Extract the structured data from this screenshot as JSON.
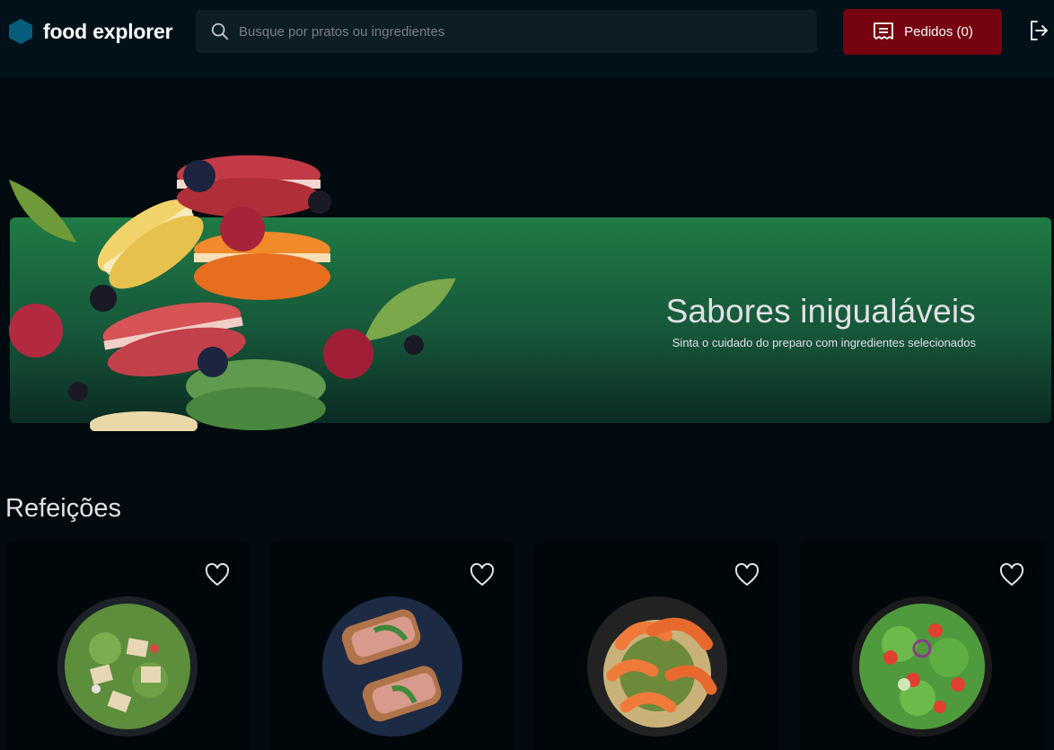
{
  "header": {
    "brand": "food explorer",
    "search_placeholder": "Busque por pratos ou ingredientes",
    "orders_label": "Pedidos (0)"
  },
  "banner": {
    "title": "Sabores inigualáveis",
    "subtitle": "Sinta o cuidado do preparo com ingredientes selecionados"
  },
  "section": {
    "title": "Refeições"
  },
  "cards": [
    {
      "icon": "heart-icon"
    },
    {
      "icon": "heart-icon"
    },
    {
      "icon": "heart-icon"
    },
    {
      "icon": "heart-icon"
    }
  ],
  "colors": {
    "background": "#000A0F",
    "header": "#00111A",
    "accent": "#750310",
    "banner": "#1F7A44",
    "logo": "#065E7C"
  }
}
